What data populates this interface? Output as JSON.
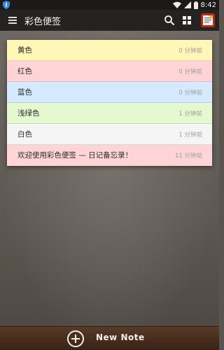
{
  "status_bar": {
    "time": "8:42"
  },
  "toolbar": {
    "title": "彩色便签"
  },
  "notes": [
    {
      "text": "黄色",
      "time": "0 分钟前",
      "color": "#fff6b8"
    },
    {
      "text": "红色",
      "time": "0 分钟前",
      "color": "#ffd4d6"
    },
    {
      "text": "蓝色",
      "time": "0 分钟前",
      "color": "#d5eaff"
    },
    {
      "text": "浅绿色",
      "time": "1 分钟前",
      "color": "#e5f9d0"
    },
    {
      "text": "白色",
      "time": "1 分钟前",
      "color": "#f5f5f5"
    },
    {
      "text": "欢迎使用彩色便签 — 日记备忘录！",
      "time": "11 分钟前",
      "color": "#ffd4d6"
    }
  ],
  "bottom_bar": {
    "new_note_label": "New Note"
  },
  "icons": {
    "menu": "hamburger-menu-icon",
    "search": "search-icon",
    "view_toggle": "grid-view-icon",
    "app": "app-icon",
    "new_note": "plus-circle-icon"
  }
}
